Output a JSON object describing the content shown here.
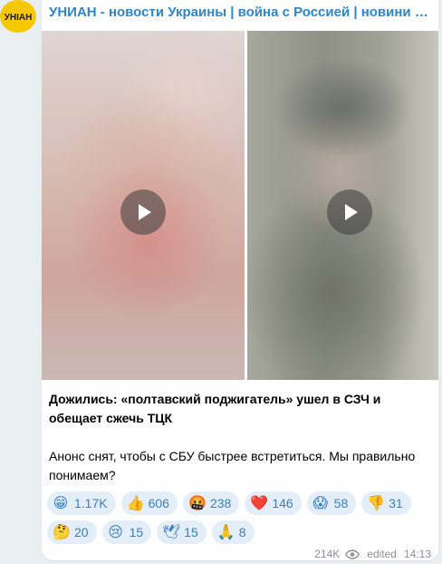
{
  "channel": {
    "title": "УНИАН - новости Украины | война с Россией | новини Украіни…",
    "avatar_icon": "unian-logo",
    "avatar_text": "УНІАН",
    "avatar_color": "#f5c800"
  },
  "media": [
    {
      "icon": "play-icon"
    },
    {
      "icon": "play-icon"
    }
  ],
  "post": {
    "headline": "Дожились: «полтавский поджигатель» ушел в СЗЧ и обещает сжечь ТЦК",
    "body": "Анонс снят, чтобы с СБУ быстрее встретиться. Мы правильно понимаем?"
  },
  "reactions": [
    {
      "emoji": "😁",
      "count": "1.17K"
    },
    {
      "emoji": "👍",
      "count": "606"
    },
    {
      "emoji": "🤬",
      "count": "238"
    },
    {
      "emoji": "❤️",
      "count": "146"
    },
    {
      "emoji": "😱",
      "count": "58"
    },
    {
      "emoji": "👎",
      "count": "31"
    },
    {
      "emoji": "🤔",
      "count": "20"
    },
    {
      "emoji": "😢",
      "count": "15"
    },
    {
      "emoji": "🕊",
      "count": "15"
    },
    {
      "emoji": "🙏",
      "count": "8"
    }
  ],
  "meta": {
    "views": "214K",
    "views_icon": "eye-icon",
    "edited": "edited",
    "time": "14:13"
  },
  "colors": {
    "link": "#2f85c9",
    "reaction_bg": "#e3eef8",
    "reaction_text": "#3a7fc1"
  }
}
